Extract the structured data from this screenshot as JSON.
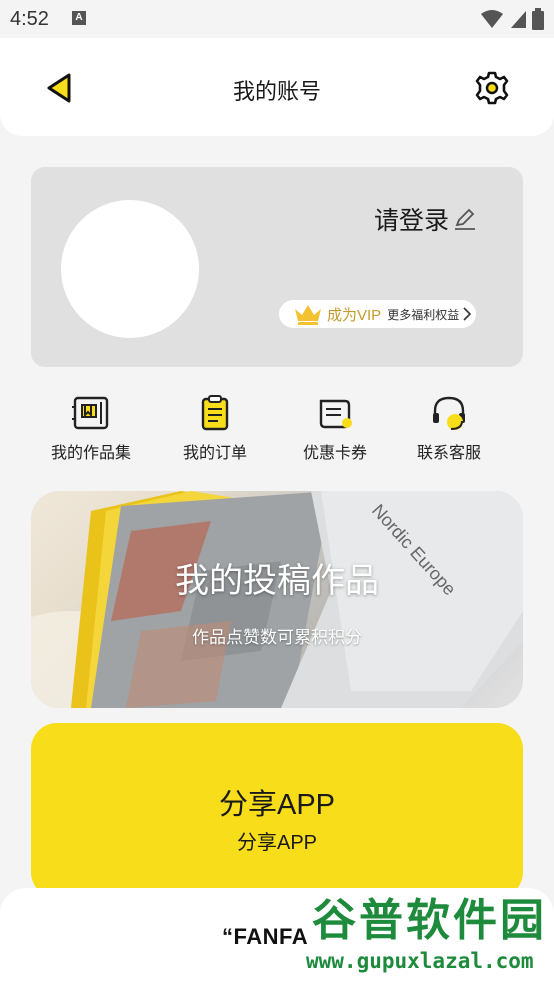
{
  "status_bar": {
    "time": "4:52",
    "notification_badge": "A"
  },
  "header": {
    "title": "我的账号"
  },
  "profile": {
    "login_text": "请登录",
    "vip_label": "成为VIP",
    "vip_more": "更多福利权益"
  },
  "quick_menu": [
    {
      "label": "我的作品集",
      "icon": "portfolio-icon"
    },
    {
      "label": "我的订单",
      "icon": "order-list-icon"
    },
    {
      "label": "优惠卡券",
      "icon": "coupon-icon"
    },
    {
      "label": "联系客服",
      "icon": "headset-icon"
    }
  ],
  "banner": {
    "title": "我的投稿作品",
    "subtitle": "作品点赞数可累积积分",
    "book_text": "Nordic Europe"
  },
  "share": {
    "title": "分享APP",
    "subtitle": "分享APP"
  },
  "bottom": {
    "brand": "“FANFA"
  },
  "watermark": {
    "logo": "谷普软件园",
    "url": "www.gupuxlazal.com"
  },
  "colors": {
    "accent_yellow": "#f8dd1b",
    "vip_gold": "#c49a2b",
    "watermark_green": "#1d8a3c"
  }
}
